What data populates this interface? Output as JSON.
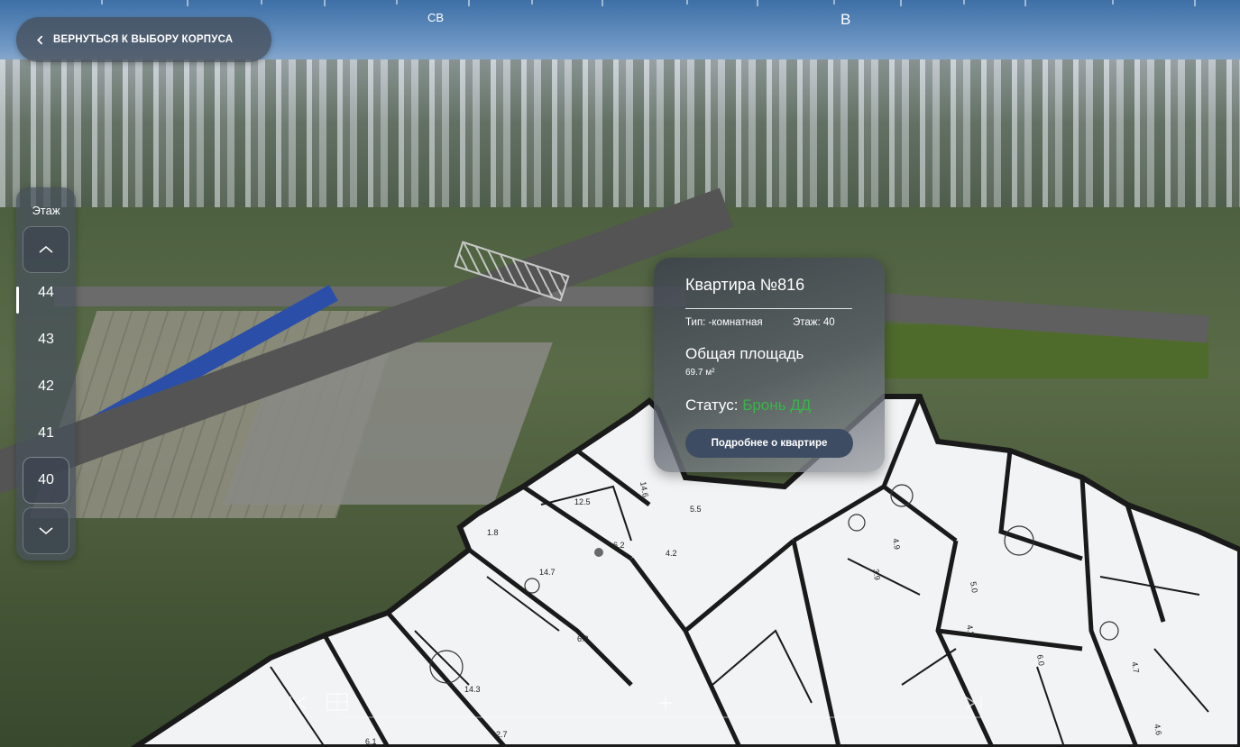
{
  "compass": {
    "northeast_label": "СВ",
    "east_label": "В"
  },
  "back_button": {
    "label": "ВЕРНУТЬСЯ К ВЫБОРУ КОРПУСА",
    "icon": "chevron-left-icon"
  },
  "floor_selector": {
    "title": "Этаж",
    "floors": [
      "44",
      "43",
      "42",
      "41",
      "40"
    ],
    "active_floor": "40",
    "up_icon": "chevron-up-icon",
    "down_icon": "chevron-down-icon"
  },
  "apartment_card": {
    "title": "Квартира №816",
    "type_text": "Тип: -комнатная",
    "floor_text": "Этаж: 40",
    "area_title": "Общая площадь",
    "area_value": "69.7 м²",
    "status_label": "Статус: ",
    "status_value": "Бронь ДД",
    "status_color": "#39b44a",
    "details_button": "Подробнее о квартире"
  },
  "plan_room_labels": [
    "1.8",
    "12.5",
    "14.6",
    "5.5",
    "6.2",
    "4.2",
    "14.7",
    "6.3",
    "14.3",
    "2.7",
    "6.1",
    "3.9",
    "4.9",
    "5.0",
    "4.2",
    "6.0",
    "4.7",
    "4.6"
  ],
  "bottom_controls": {
    "icons": [
      "skip-back-icon",
      "floor-plan-icon",
      "zoom-in-icon",
      "skip-forward-icon"
    ]
  }
}
